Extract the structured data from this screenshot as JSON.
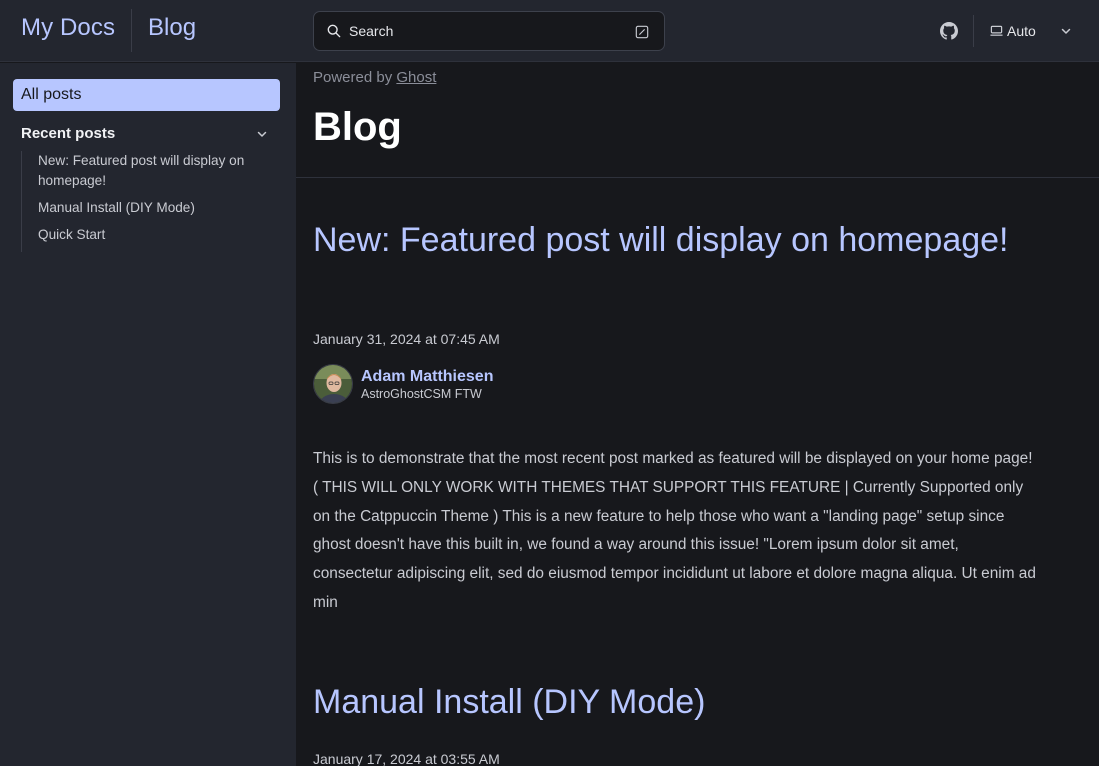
{
  "header": {
    "site_title": "My Docs",
    "blog_link": "Blog",
    "search_label": "Search",
    "theme_label": "Auto",
    "icons": [
      "search-icon",
      "kbd-slash-icon",
      "github-icon",
      "monitor-icon",
      "chevron-down-icon"
    ]
  },
  "sidebar": {
    "all_posts": "All posts",
    "recent_heading": "Recent posts",
    "recent_items": [
      "New: Featured post will display on homepage!",
      "Manual Install (DIY Mode)",
      "Quick Start"
    ]
  },
  "main": {
    "powered_prefix": "Powered by",
    "powered_link": "Ghost",
    "page_title": "Blog",
    "posts": [
      {
        "title": "New: Featured post will display on homepage!",
        "date": "January 31, 2024 at 07:45 AM",
        "author_name": "Adam Matthiesen",
        "author_bio": "AstroGhostCSM FTW",
        "excerpt": "This is to demonstrate that the most recent post marked as featured will be displayed on your home page! ( THIS WILL ONLY WORK WITH THEMES THAT SUPPORT THIS FEATURE | Currently Supported only on the Catppuccin Theme ) This is a new feature to help those who want a \"landing page\" setup since ghost doesn't have this built in, we found a way around this issue! \"Lorem ipsum dolor sit amet, consectetur adipiscing elit, sed do eiusmod tempor incididunt ut labore et dolore magna aliqua. Ut enim ad min"
      },
      {
        "title": "Manual Install (DIY Mode)",
        "date": "January 17, 2024 at 03:55 AM"
      }
    ]
  },
  "colors": {
    "accent": "#b7c6ff",
    "background": "#17181c",
    "panel": "#23262f"
  }
}
